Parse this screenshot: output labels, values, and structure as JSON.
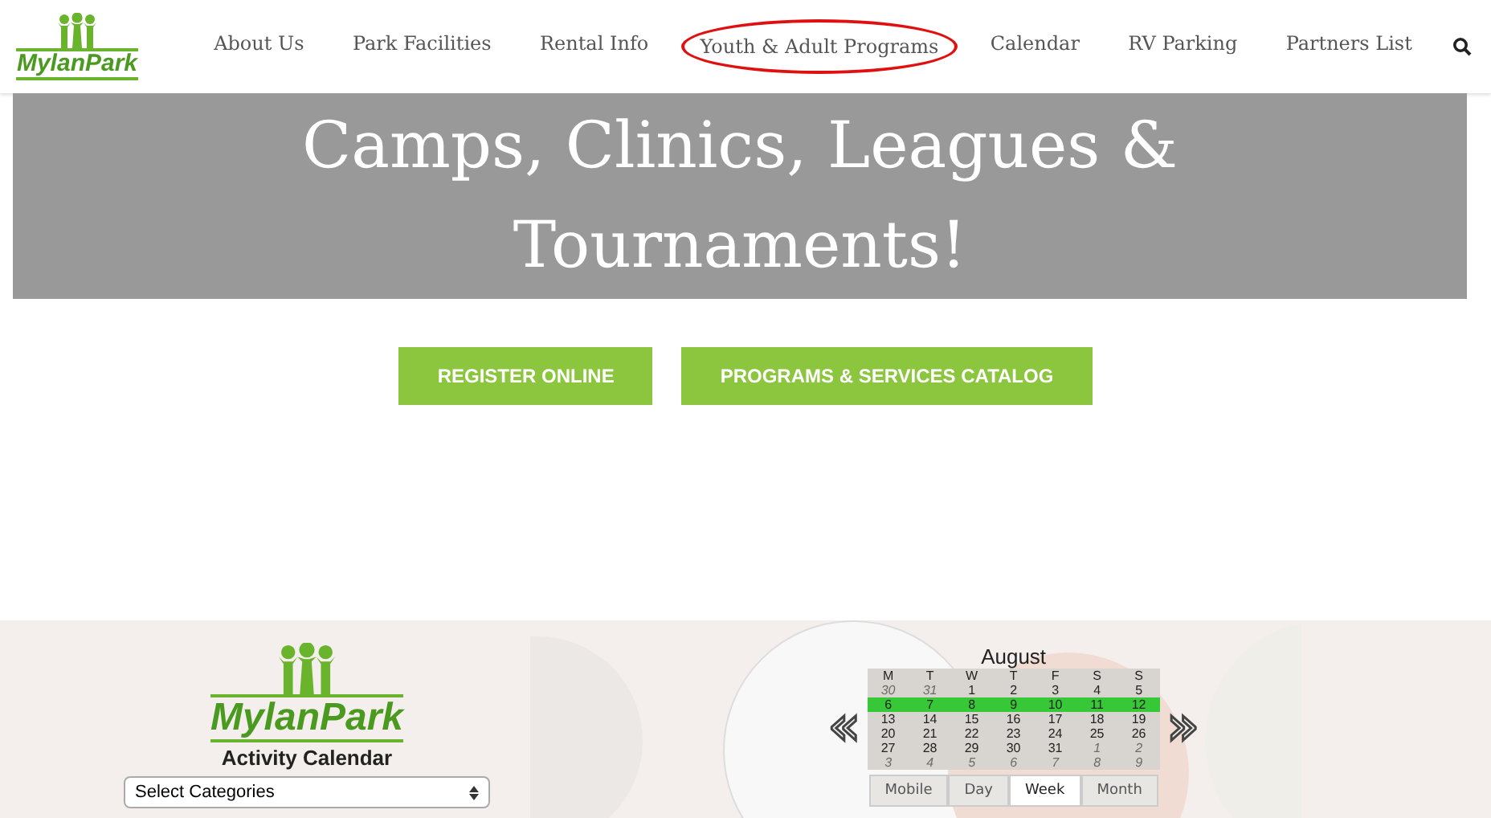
{
  "header": {
    "logo_text": "MylanPark",
    "nav": [
      {
        "label": "About Us",
        "circled": false
      },
      {
        "label": "Park Facilities",
        "circled": false
      },
      {
        "label": "Rental Info",
        "circled": false
      },
      {
        "label": "Youth & Adult Programs",
        "circled": true
      },
      {
        "label": "Calendar",
        "circled": false
      },
      {
        "label": "RV Parking",
        "circled": false
      },
      {
        "label": "Partners List",
        "circled": false
      }
    ]
  },
  "hero": {
    "heading_lines": [
      "Camps, Clinics, Leagues &",
      "Tournaments!"
    ]
  },
  "buttons": [
    "REGISTER ONLINE",
    "PROGRAMS & SERVICES CATALOG"
  ],
  "activity_calendar": {
    "logo_text": "MylanPark",
    "subtitle": "Activity Calendar",
    "category_select": {
      "value": "Select Categories"
    },
    "prev": "«",
    "next": "»",
    "calendar": {
      "month": "August",
      "weekdays": [
        "M",
        "T",
        "W",
        "T",
        "F",
        "S",
        "S"
      ],
      "weeks": [
        {
          "selected": false,
          "days": [
            {
              "label": "30",
              "muted": true
            },
            {
              "label": "31",
              "muted": true
            },
            {
              "label": "1",
              "muted": false
            },
            {
              "label": "2",
              "muted": false
            },
            {
              "label": "3",
              "muted": false
            },
            {
              "label": "4",
              "muted": false
            },
            {
              "label": "5",
              "muted": false
            }
          ]
        },
        {
          "selected": true,
          "days": [
            {
              "label": "6",
              "muted": false
            },
            {
              "label": "7",
              "muted": false
            },
            {
              "label": "8",
              "muted": false
            },
            {
              "label": "9",
              "muted": false
            },
            {
              "label": "10",
              "muted": false
            },
            {
              "label": "11",
              "muted": false
            },
            {
              "label": "12",
              "muted": false
            }
          ]
        },
        {
          "selected": false,
          "days": [
            {
              "label": "13",
              "muted": false
            },
            {
              "label": "14",
              "muted": false
            },
            {
              "label": "15",
              "muted": false
            },
            {
              "label": "16",
              "muted": false
            },
            {
              "label": "17",
              "muted": false
            },
            {
              "label": "18",
              "muted": false
            },
            {
              "label": "19",
              "muted": false
            }
          ]
        },
        {
          "selected": false,
          "days": [
            {
              "label": "20",
              "muted": false
            },
            {
              "label": "21",
              "muted": false
            },
            {
              "label": "22",
              "muted": false
            },
            {
              "label": "23",
              "muted": false
            },
            {
              "label": "24",
              "muted": false
            },
            {
              "label": "25",
              "muted": false
            },
            {
              "label": "26",
              "muted": false
            }
          ]
        },
        {
          "selected": false,
          "days": [
            {
              "label": "27",
              "muted": false
            },
            {
              "label": "28",
              "muted": false
            },
            {
              "label": "29",
              "muted": false
            },
            {
              "label": "30",
              "muted": false
            },
            {
              "label": "31",
              "muted": false
            },
            {
              "label": "1",
              "muted": true
            },
            {
              "label": "2",
              "muted": true
            }
          ]
        },
        {
          "selected": false,
          "days": [
            {
              "label": "3",
              "muted": true
            },
            {
              "label": "4",
              "muted": true
            },
            {
              "label": "5",
              "muted": true
            },
            {
              "label": "6",
              "muted": true
            },
            {
              "label": "7",
              "muted": true
            },
            {
              "label": "8",
              "muted": true
            },
            {
              "label": "9",
              "muted": true
            }
          ]
        }
      ]
    },
    "views": [
      {
        "label": "Mobile",
        "selected": false
      },
      {
        "label": "Day",
        "selected": false
      },
      {
        "label": "Week",
        "selected": true
      },
      {
        "label": "Month",
        "selected": false
      }
    ]
  }
}
